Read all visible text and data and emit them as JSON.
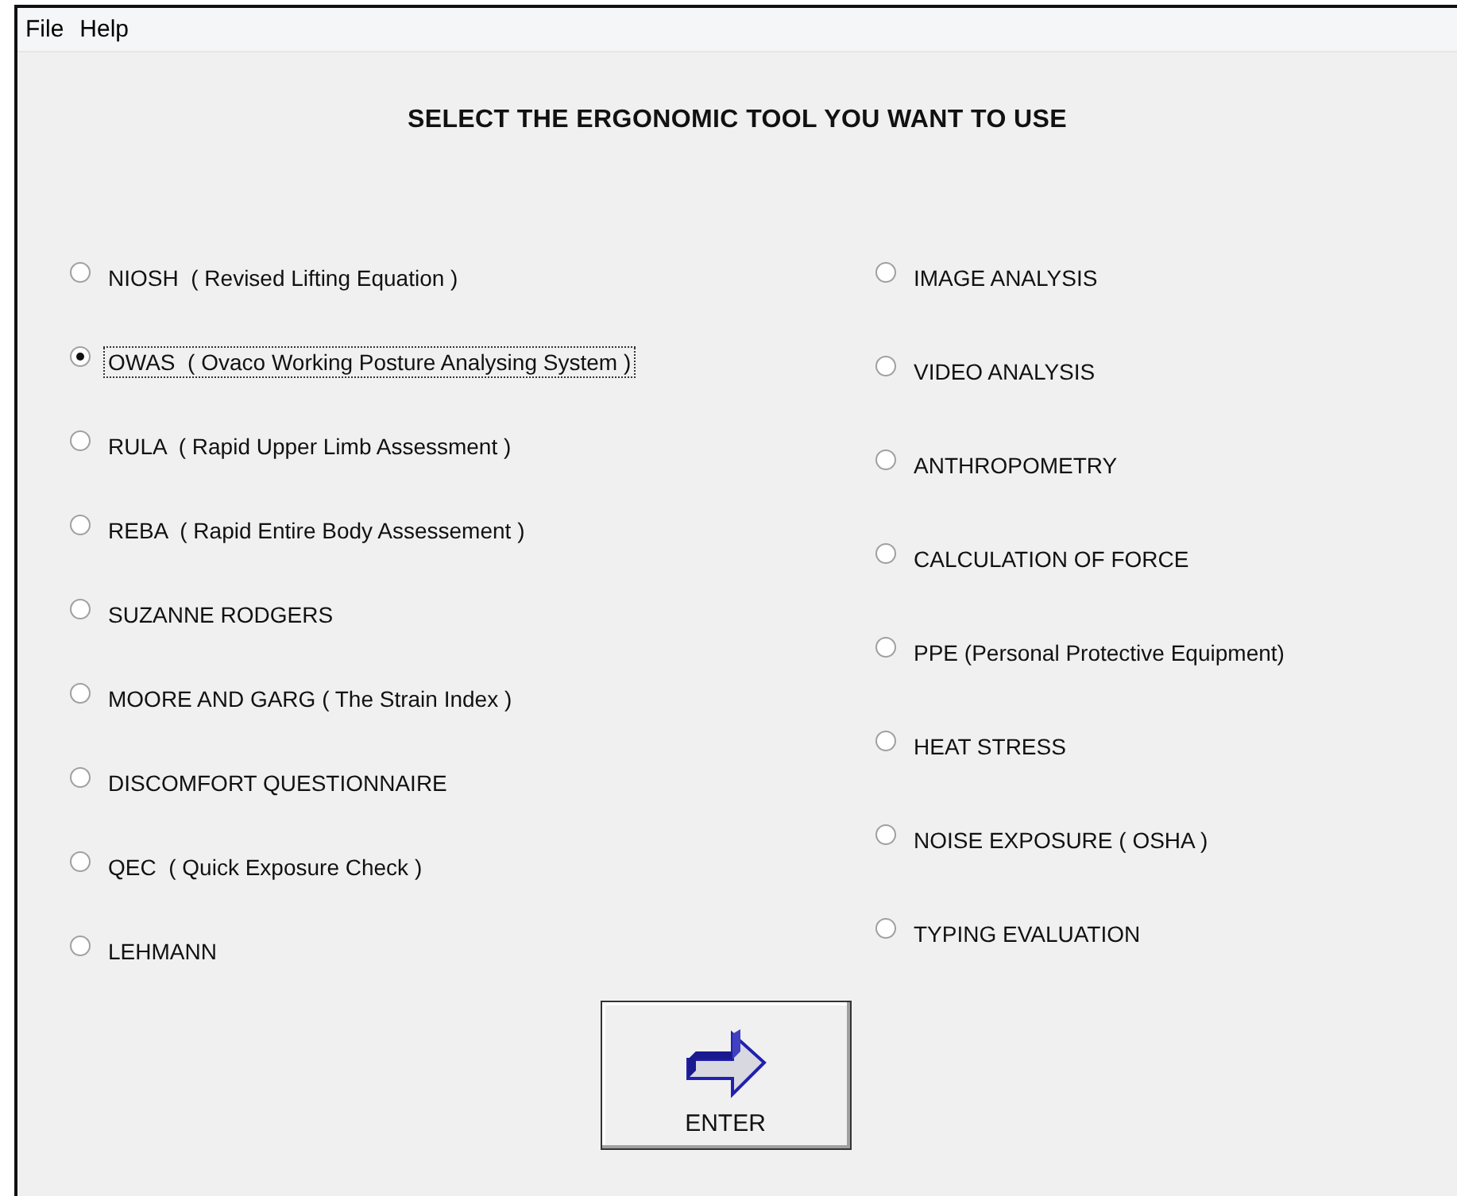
{
  "menu": [
    {
      "label": "File"
    },
    {
      "label": "Help"
    }
  ],
  "title": "SELECT THE ERGONOMIC TOOL YOU WANT TO USE",
  "left_options": [
    {
      "label": "NIOSH  ( Revised Lifting Equation )",
      "selected": false
    },
    {
      "label": "OWAS  ( Ovaco Working Posture Analysing System )",
      "selected": true
    },
    {
      "label": "RULA  ( Rapid Upper Limb Assessment )",
      "selected": false
    },
    {
      "label": "REBA  ( Rapid Entire Body Assessement )",
      "selected": false
    },
    {
      "label": "SUZANNE RODGERS",
      "selected": false
    },
    {
      "label": "MOORE AND GARG ( The Strain Index )",
      "selected": false
    },
    {
      "label": "DISCOMFORT QUESTIONNAIRE",
      "selected": false
    },
    {
      "label": "QEC  ( Quick Exposure Check )",
      "selected": false
    },
    {
      "label": "LEHMANN",
      "selected": false
    }
  ],
  "right_options": [
    {
      "label": "IMAGE ANALYSIS",
      "selected": false
    },
    {
      "label": "VIDEO ANALYSIS",
      "selected": false
    },
    {
      "label": "ANTHROPOMETRY",
      "selected": false
    },
    {
      "label": "CALCULATION OF FORCE",
      "selected": false
    },
    {
      "label": "PPE (Personal Protective Equipment)",
      "selected": false
    },
    {
      "label": "HEAT STRESS",
      "selected": false
    },
    {
      "label": "NOISE EXPOSURE ( OSHA )",
      "selected": false
    },
    {
      "label": "TYPING EVALUATION",
      "selected": false
    }
  ],
  "enter_button": {
    "label": "ENTER"
  }
}
